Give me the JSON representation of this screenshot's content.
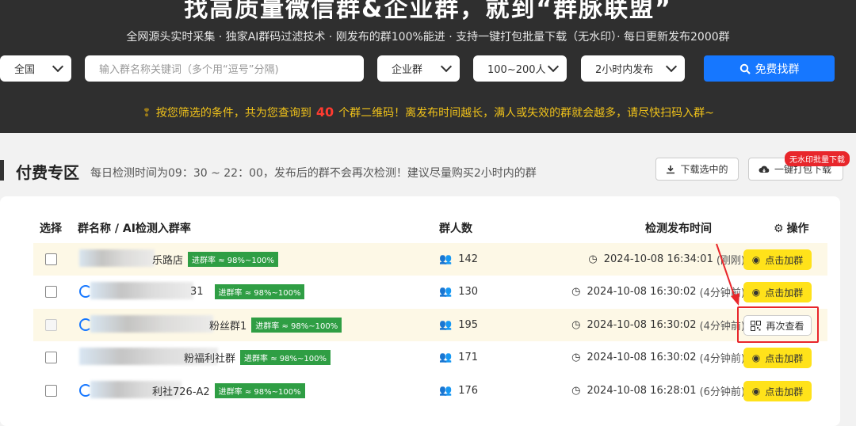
{
  "hero": {
    "title": "找高质量微信群&企业群，就到“群脉联盟”",
    "subtitle": "全网源头实时采集 · 独家AI群码过滤技术 · 刚发布的群100%能进 · 支持一键打包批量下载（无水印）· 每日更新发布2000群"
  },
  "filters": {
    "region": "全国",
    "keyword_placeholder": "输入群名称关键词（多个用“逗号”分隔)",
    "group_type": "企业群",
    "size": "100~200人",
    "publish_time": "2小时内发布",
    "search_button": "免费找群"
  },
  "notice": {
    "pre": "按您筛选的条件，共为您查询到",
    "count": "40",
    "post": "个群二维码！离发布时间越长，满人或失效的群就会越多，请尽快扫码入群~"
  },
  "section": {
    "title": "付费专区",
    "desc": "每日检测时间为09：30 ~ 22：00，发布后的群不会再次检测！建议尽量购买2小时内的群",
    "download_selected": "下载选中的",
    "download_all": "一键打包下载",
    "badge": "无水印批量下载"
  },
  "table": {
    "headers": {
      "select": "选择",
      "name": "群名称 / AI检测入群率",
      "members": "群人数",
      "time": "检测发布时间",
      "action": "操作"
    },
    "rows": [
      {
        "name": "乐路店",
        "rate": "进群率 ≈ 98%~100%",
        "members": "142",
        "time": "2024-10-08 16:34:01",
        "ago": "(刚刚)",
        "action": "点击加群"
      },
      {
        "name": "31",
        "rate": "进群率 ≈ 98%~100%",
        "members": "130",
        "time": "2024-10-08 16:30:02",
        "ago": "(4分钟前)",
        "action": "点击加群"
      },
      {
        "name": "粉丝群1",
        "rate": "进群率 ≈ 98%~100%",
        "members": "195",
        "time": "2024-10-08 16:30:02",
        "ago": "(4分钟前)",
        "action": "再次查看"
      },
      {
        "name": "粉福利社群",
        "rate": "进群率 ≈ 98%~100%",
        "members": "171",
        "time": "2024-10-08 16:30:02",
        "ago": "(4分钟前)",
        "action": "点击加群"
      },
      {
        "name": "利社726-A2",
        "rate": "进群率 ≈ 98%~100%",
        "members": "176",
        "time": "2024-10-08 16:28:01",
        "ago": "(6分钟前)",
        "action": "点击加群"
      }
    ]
  },
  "colors": {
    "accent": "#1677ff",
    "join": "#ffe21a",
    "tag": "#2f9e44",
    "highlight": "#e8262b"
  }
}
